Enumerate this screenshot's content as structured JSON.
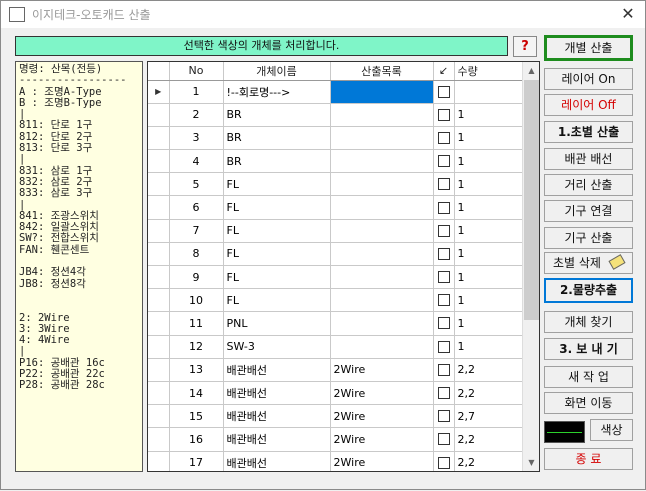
{
  "window": {
    "title": "이지테크-오토캐드 산출"
  },
  "message": "선택한 색상의 개체를 처리합니다.",
  "help_label": "?",
  "legend": "명령: 산목(전등)\n-----------------\nA : 조명A-Type\nB : 조명B-Type\n|\n811: 단로 1구\n812: 단로 2구\n813: 단로 3구\n|\n831: 삼로 1구\n832: 삼로 2구\n833: 삼로 3구\n|\n841: 조광스위치\n842: 일괄스위치\nSW?: 전합스위치\nFAN: 휀콘센트\n\nJB4: 정션4각\nJB8: 정션8각\n\n\n2: 2Wire\n3: 3Wire\n4: 4Wire\n|\nP16: 공배관 16c\nP22: 공배관 22c\nP28: 공배관 28c",
  "table": {
    "headers": {
      "no": "No",
      "name": "개체이름",
      "item": "산출목록",
      "check": "↙",
      "qty": "수량"
    },
    "rows": [
      {
        "no": "1",
        "name": "!--회로명--->",
        "item": "",
        "qty": ""
      },
      {
        "no": "2",
        "name": "BR",
        "item": "",
        "qty": "1"
      },
      {
        "no": "3",
        "name": "BR",
        "item": "",
        "qty": "1"
      },
      {
        "no": "4",
        "name": "BR",
        "item": "",
        "qty": "1"
      },
      {
        "no": "5",
        "name": "FL",
        "item": "",
        "qty": "1"
      },
      {
        "no": "6",
        "name": "FL",
        "item": "",
        "qty": "1"
      },
      {
        "no": "7",
        "name": "FL",
        "item": "",
        "qty": "1"
      },
      {
        "no": "8",
        "name": "FL",
        "item": "",
        "qty": "1"
      },
      {
        "no": "9",
        "name": "FL",
        "item": "",
        "qty": "1"
      },
      {
        "no": "10",
        "name": "FL",
        "item": "",
        "qty": "1"
      },
      {
        "no": "11",
        "name": "PNL",
        "item": "",
        "qty": "1"
      },
      {
        "no": "12",
        "name": "SW-3",
        "item": "",
        "qty": "1"
      },
      {
        "no": "13",
        "name": "배관배선",
        "item": "2Wire",
        "qty": "2,2"
      },
      {
        "no": "14",
        "name": "배관배선",
        "item": "2Wire",
        "qty": "2,2"
      },
      {
        "no": "15",
        "name": "배관배선",
        "item": "2Wire",
        "qty": "2,7"
      },
      {
        "no": "16",
        "name": "배관배선",
        "item": "2Wire",
        "qty": "2,2"
      },
      {
        "no": "17",
        "name": "배관배선",
        "item": "2Wire",
        "qty": "2,2"
      }
    ]
  },
  "buttons": {
    "individual_calc": "개별 산출",
    "layer_on": "레이어 On",
    "layer_off": "레이어 Off",
    "step1_calc": "1.초별 산출",
    "pipe_wire": "배관 배선",
    "distance_calc": "거리 산출",
    "fixture_link": "기구 연결",
    "fixture_calc": "기구 산출",
    "step_delete": "초별 삭제",
    "step2_extract": "2.물량추출",
    "find_object": "개체 찾기",
    "step3_send": "3. 보 내 기",
    "new_job": "새 작 업",
    "move_screen": "화면 이동",
    "color": "색상",
    "exit": "종 료"
  },
  "colors": {
    "message_bg": "#7ff5c8",
    "legend_bg": "#ffffe1",
    "selection": "#0078d7",
    "swatch": "#000000",
    "swatch_line": "#2bd12b"
  }
}
